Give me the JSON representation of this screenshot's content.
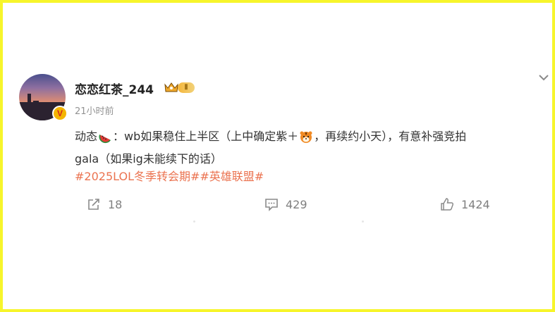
{
  "post": {
    "username": "恋恋红茶_244",
    "level_badge": "Ⅱ",
    "verified_mark": "V",
    "time": "21小时前",
    "text_prefix": "动态",
    "text_part1": "：wb如果稳住上半区（上中确定紫＋",
    "text_part2": "，再续约小天），有意补强竞拍",
    "text_line2": "gala（如果ig未能续下的话）",
    "hashtags": "#2025LOL冬季转会期##英雄联盟#"
  },
  "actions": {
    "repost_count": "18",
    "comment_count": "429",
    "like_count": "1424"
  },
  "icons": [
    "watermelon-emoji-icon",
    "tiger-emoji-icon",
    "crown-icon",
    "chevron-down-icon",
    "share-icon",
    "comment-icon",
    "like-icon"
  ],
  "colors": {
    "frame": "#f7f52b",
    "hashtag": "#eb7350",
    "muted": "#939393",
    "verified": "#f4b400"
  }
}
